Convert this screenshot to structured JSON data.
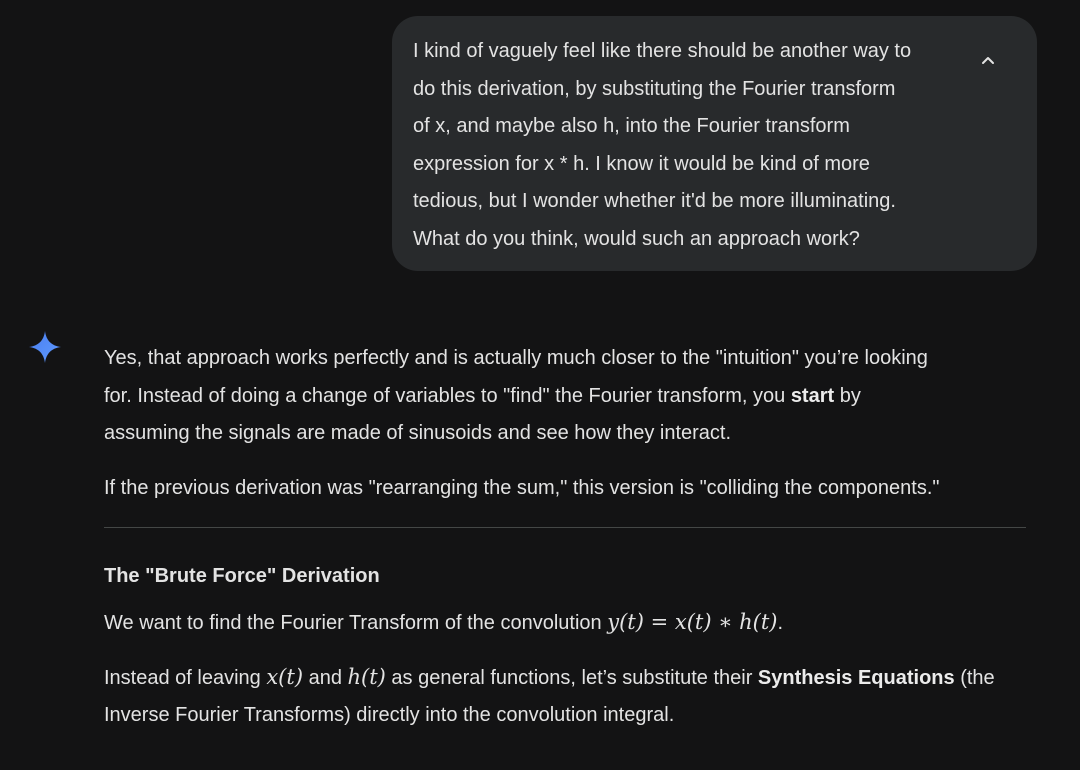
{
  "user_message": {
    "text": "I kind of vaguely feel like there should be another way to\ndo this derivation, by substituting the Fourier transform\nof x, and maybe also h, into the Fourier transform\nexpression for x * h. I know it would be kind of more\ntedious, but I wonder whether it'd be more illuminating.\nWhat do you think, would such an approach work?",
    "collapse_icon": "chevron-up-icon"
  },
  "assistant": {
    "icon": "gemini-sparkle-icon",
    "icon_color": "#4c8df6",
    "p1_a": "Yes, that approach works perfectly and is actually much closer to the \"intuition\" you’re looking\nfor. Instead of doing a change of variables to \"find\" the Fourier transform, you ",
    "p1_bold": "start",
    "p1_b": " by\nassuming the signals are made of sinusoids and see how they interact.",
    "p2": "If the previous derivation was \"rearranging the sum,\" this version is \"colliding the components.\"",
    "heading": "The \"Brute Force\" Derivation",
    "p3_a": "We want to find the Fourier Transform of the convolution ",
    "p3_math": "y(t) = x(t) ∗ h(t)",
    "p3_b": ".",
    "p4_a": "Instead of leaving ",
    "p4_math1": "x(t)",
    "p4_and": " and ",
    "p4_math2": "h(t)",
    "p4_b": " as general functions, let’s substitute their ",
    "p4_bold": "Synthesis Equations",
    "p4_c": " (the Inverse Fourier Transforms) directly into the convolution integral."
  },
  "colors": {
    "background": "#131314",
    "bubble": "#282a2c",
    "text": "#e3e3e3",
    "divider": "#444746"
  }
}
